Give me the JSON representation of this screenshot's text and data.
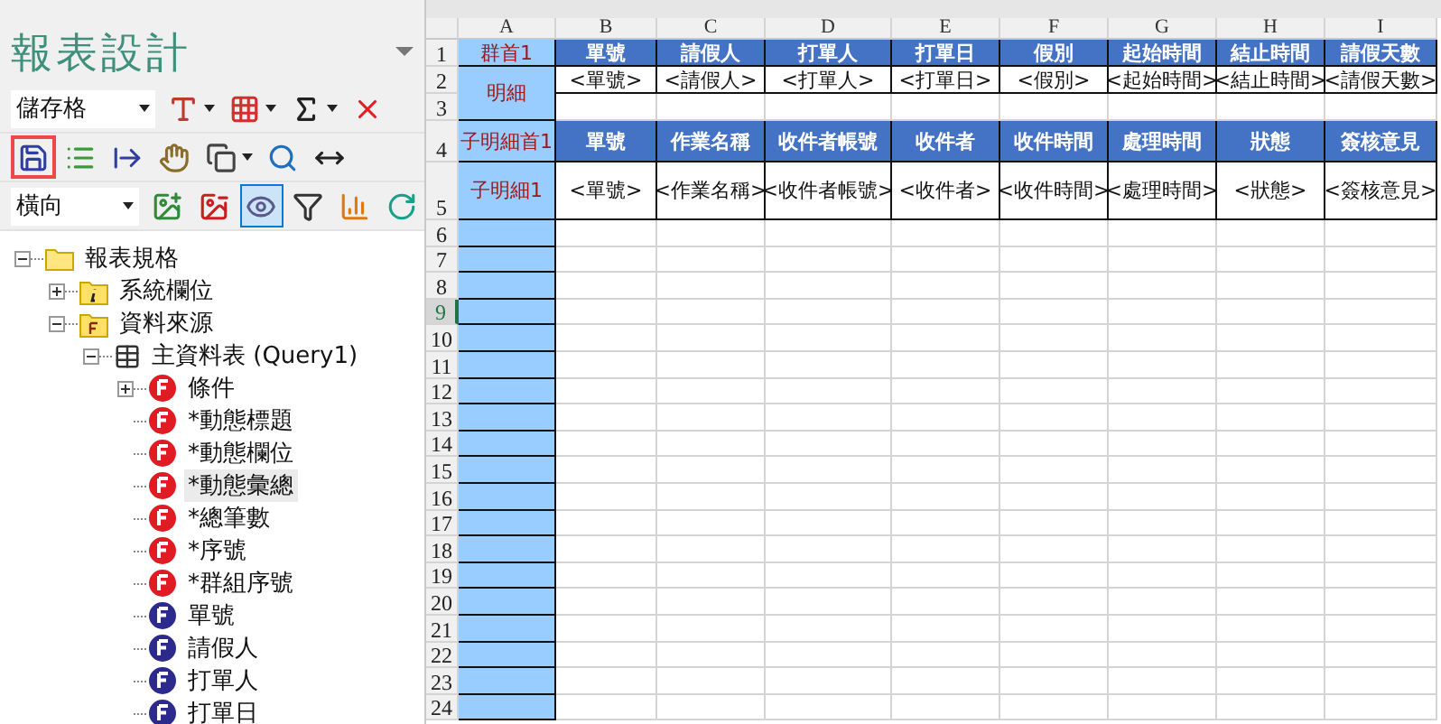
{
  "panel": {
    "title": "報表設計",
    "toolbar_rows": [
      {
        "select": "儲存格",
        "buttons": [
          {
            "dropdown": true,
            "pressed": false,
            "highlighted": false
          },
          {
            "dropdown": true,
            "pressed": false,
            "highlighted": false
          },
          {
            "dropdown": true,
            "pressed": false,
            "highlighted": false
          },
          {
            "dropdown": false,
            "pressed": false,
            "highlighted": false
          }
        ]
      },
      {
        "buttons": [
          {
            "dropdown": false,
            "pressed": false,
            "highlighted": true
          },
          {
            "dropdown": false,
            "pressed": false,
            "highlighted": false
          },
          {
            "dropdown": false,
            "pressed": false,
            "highlighted": false
          },
          {
            "dropdown": false,
            "pressed": false,
            "highlighted": false
          },
          {
            "dropdown": true,
            "pressed": false,
            "highlighted": false
          },
          {
            "dropdown": false,
            "pressed": false,
            "highlighted": false
          },
          {
            "dropdown": false,
            "pressed": false,
            "highlighted": false
          }
        ]
      },
      {
        "select": "橫向",
        "buttons": [
          {
            "dropdown": false,
            "pressed": false,
            "highlighted": false
          },
          {
            "dropdown": false,
            "pressed": false,
            "highlighted": false
          },
          {
            "dropdown": false,
            "pressed": true,
            "highlighted": false
          },
          {
            "dropdown": false,
            "pressed": false,
            "highlighted": false
          },
          {
            "dropdown": false,
            "pressed": false,
            "highlighted": false
          },
          {
            "dropdown": false,
            "pressed": false,
            "highlighted": false
          }
        ]
      }
    ],
    "tree": [
      {
        "label": "報表規格",
        "kind": "folder",
        "expanded": true,
        "selected": false,
        "children": [
          {
            "label": "系統欄位",
            "kind": "info",
            "expanded": false,
            "selected": false
          },
          {
            "label": "資料來源",
            "kind": "source",
            "expanded": true,
            "selected": false,
            "children": [
              {
                "label": "主資料表 (Query1)",
                "kind": "table",
                "expanded": true,
                "selected": false,
                "children": [
                  {
                    "label": "條件",
                    "kind": "dynamic-field",
                    "expanded": false,
                    "selected": false
                  },
                  {
                    "label": "*動態標題",
                    "kind": "dynamic-field",
                    "selected": false
                  },
                  {
                    "label": "*動態欄位",
                    "kind": "dynamic-field",
                    "selected": false
                  },
                  {
                    "label": "*動態彙總",
                    "kind": "dynamic-field",
                    "selected": true
                  },
                  {
                    "label": "*總筆數",
                    "kind": "dynamic-field",
                    "selected": false
                  },
                  {
                    "label": "*序號",
                    "kind": "dynamic-field",
                    "selected": false
                  },
                  {
                    "label": "*群組序號",
                    "kind": "dynamic-field",
                    "selected": false
                  },
                  {
                    "label": "單號",
                    "kind": "field",
                    "selected": false
                  },
                  {
                    "label": "請假人",
                    "kind": "field",
                    "selected": false
                  },
                  {
                    "label": "打單人",
                    "kind": "field",
                    "selected": false
                  },
                  {
                    "label": "打單日",
                    "kind": "field",
                    "selected": false
                  }
                ]
              }
            ]
          }
        ]
      }
    ]
  },
  "sheet": {
    "columns": [
      "A",
      "B",
      "C",
      "D",
      "E",
      "F",
      "G",
      "H",
      "I"
    ],
    "row_numbers": [
      {
        "label": "1",
        "selected": false
      },
      {
        "label": "2",
        "selected": false
      },
      {
        "label": "3",
        "selected": false
      },
      {
        "label": "4",
        "selected": false
      },
      {
        "label": "5",
        "selected": false
      },
      {
        "label": "6",
        "selected": false
      },
      {
        "label": "7",
        "selected": false
      },
      {
        "label": "8",
        "selected": false
      },
      {
        "label": "9",
        "selected": true
      },
      {
        "label": "10",
        "selected": false
      },
      {
        "label": "11",
        "selected": false
      },
      {
        "label": "12",
        "selected": false
      },
      {
        "label": "13",
        "selected": false
      },
      {
        "label": "14",
        "selected": false
      },
      {
        "label": "15",
        "selected": false
      },
      {
        "label": "16",
        "selected": false
      },
      {
        "label": "17",
        "selected": false
      },
      {
        "label": "18",
        "selected": false
      },
      {
        "label": "19",
        "selected": false
      },
      {
        "label": "20",
        "selected": false
      },
      {
        "label": "21",
        "selected": false
      },
      {
        "label": "22",
        "selected": false
      },
      {
        "label": "23",
        "selected": false
      },
      {
        "label": "24",
        "selected": false
      }
    ],
    "group_header": {
      "label": "群首1",
      "headers": [
        "單號",
        "請假人",
        "打單人",
        "打單日",
        "假別",
        "起始時間",
        "結止時間",
        "請假天數"
      ]
    },
    "detail": {
      "label": "明細",
      "values": [
        "<單號>",
        "<請假人>",
        "<打單人>",
        "<打單日>",
        "<假別>",
        "<起始時間>",
        "<結止時間>",
        "<請假天數>"
      ]
    },
    "sub_header": {
      "label": "子明細首1",
      "headers": [
        "單號",
        "作業名稱",
        "收件者帳號",
        "收件者",
        "收件時間",
        "處理時間",
        "狀態",
        "簽核意見"
      ]
    },
    "sub_detail": {
      "label": "子明細1",
      "values": [
        "<單號>",
        "<作業名稱>",
        "<收件者帳號>",
        "<收件者>",
        "<收件時間>",
        "<處理時間>",
        "<狀態>",
        "<簽核意見>"
      ]
    }
  }
}
